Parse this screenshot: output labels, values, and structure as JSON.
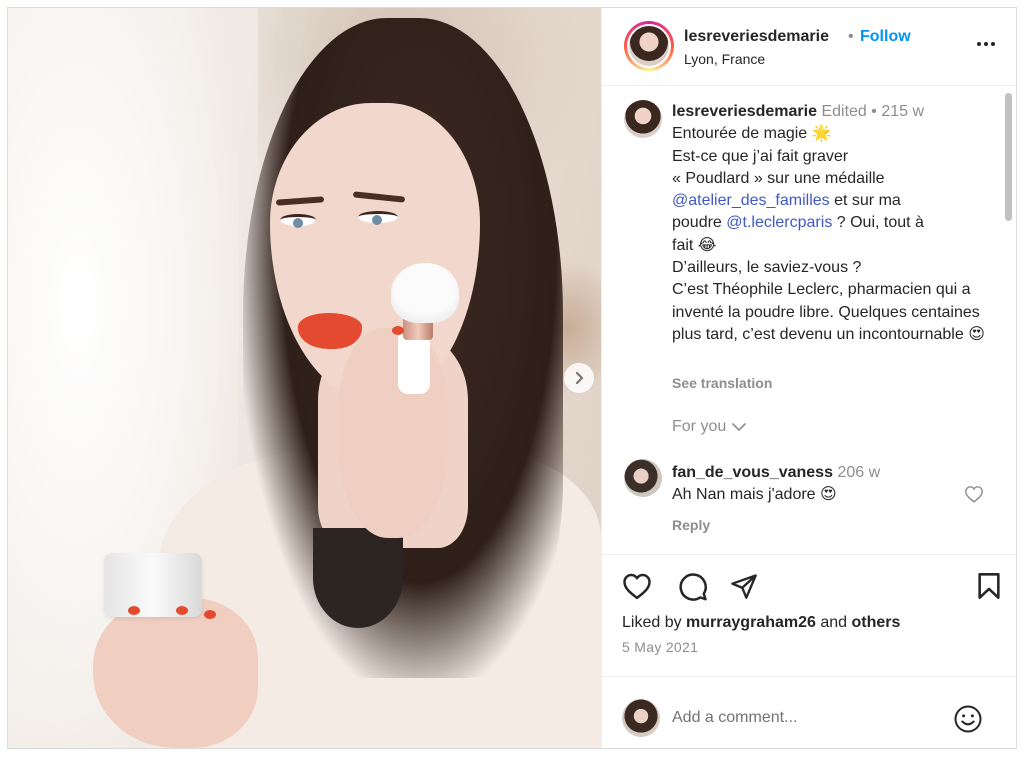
{
  "header": {
    "username": "lesreveriesdemarie",
    "separator": "•",
    "follow_label": "Follow",
    "location": "Lyon, France",
    "more_icon": "more-horizontal-icon"
  },
  "photo": {
    "next_icon": "chevron-right-icon",
    "carousel_dots": 2,
    "active_dot": 1
  },
  "caption": {
    "username": "lesreveriesdemarie",
    "edited": "Edited",
    "dot": "•",
    "age": "215 w",
    "line1": "Entourée de magie 🌟",
    "line2": "Est-ce que j’ai fait graver",
    "line3": "« Poudlard » sur une médaille",
    "mention1": "@atelier_des_familles",
    "line4_after": " et sur ma",
    "line5_before": "poudre ",
    "mention2": "@t.leclercparis",
    "line5_after": " ? Oui, tout à",
    "line6": "fait 😂",
    "line7": "D’ailleurs, le saviez-vous ?",
    "line8": "C’est Théophile Leclerc, pharmacien qui a inventé la poudre libre. Quelques centaines plus tard, c’est devenu un incontournable 😍",
    "see_translation": "See translation",
    "for_you": "For you"
  },
  "comment": {
    "username": "fan_de_vous_vaness",
    "age": "206 w",
    "text": "Ah Nan mais j'adore 😍",
    "reply": "Reply",
    "like_icon": "heart-outline-icon"
  },
  "actions": {
    "like_icon": "heart-icon",
    "comment_icon": "comment-icon",
    "share_icon": "send-icon",
    "save_icon": "bookmark-icon"
  },
  "likes": {
    "prefix": "Liked by ",
    "user": "murraygraham26",
    "middle": " and ",
    "others": "others"
  },
  "date": "5 May 2021",
  "add_comment": {
    "placeholder": "Add a comment...",
    "emoji_icon": "smiley-icon"
  }
}
